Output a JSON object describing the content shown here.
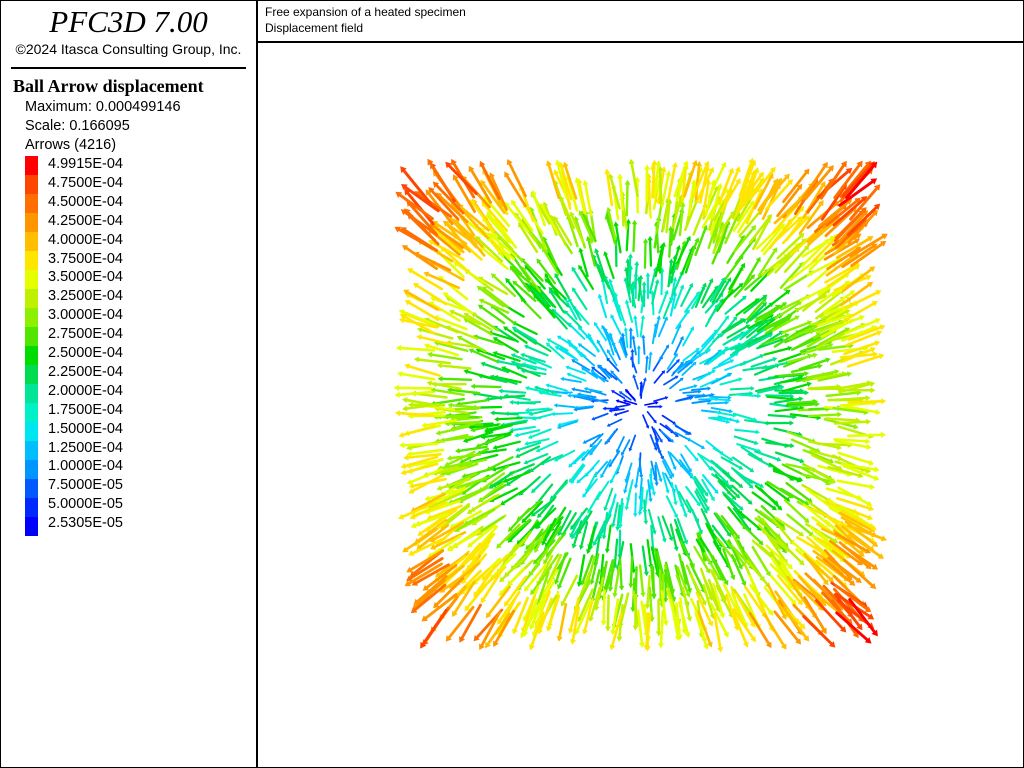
{
  "app": {
    "title": "PFC3D 7.00",
    "copyright": "©2024 Itasca Consulting Group, Inc."
  },
  "header": {
    "line1": "Free expansion of a heated specimen",
    "line2": "Displacement field"
  },
  "legend": {
    "title": "Ball Arrow displacement",
    "maximum": "Maximum: 0.000499146",
    "scale": "Scale: 0.166095",
    "arrows": "Arrows (4216)",
    "entries": [
      {
        "label": "4.9915E-04",
        "color": "#ff0000"
      },
      {
        "label": "4.7500E-04",
        "color": "#ff4600"
      },
      {
        "label": "4.5000E-04",
        "color": "#ff6e00"
      },
      {
        "label": "4.2500E-04",
        "color": "#ff9600"
      },
      {
        "label": "4.0000E-04",
        "color": "#ffbe00"
      },
      {
        "label": "3.7500E-04",
        "color": "#ffe600"
      },
      {
        "label": "3.5000E-04",
        "color": "#e6ff00"
      },
      {
        "label": "3.2500E-04",
        "color": "#bef000"
      },
      {
        "label": "3.0000E-04",
        "color": "#8cf000"
      },
      {
        "label": "2.7500E-04",
        "color": "#50e600"
      },
      {
        "label": "2.5000E-04",
        "color": "#00dc00"
      },
      {
        "label": "2.2500E-04",
        "color": "#00dc50"
      },
      {
        "label": "2.0000E-04",
        "color": "#00e696"
      },
      {
        "label": "1.7500E-04",
        "color": "#00f0c8"
      },
      {
        "label": "1.5000E-04",
        "color": "#00e6f0"
      },
      {
        "label": "1.2500E-04",
        "color": "#00beff"
      },
      {
        "label": "1.0000E-04",
        "color": "#0096ff"
      },
      {
        "label": "7.5000E-05",
        "color": "#005aff"
      },
      {
        "label": "5.0000E-05",
        "color": "#0028ff"
      },
      {
        "label": "2.5305E-05",
        "color": "#0000ff"
      }
    ]
  }
}
